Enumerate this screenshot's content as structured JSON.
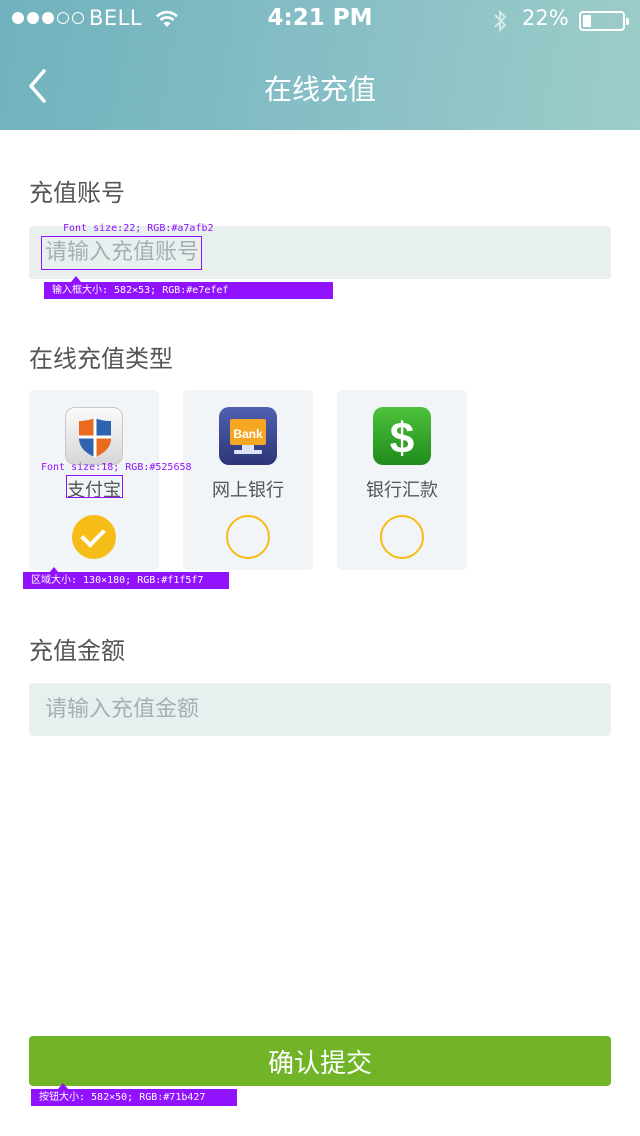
{
  "status_bar": {
    "carrier": "BELL",
    "time": "4:21 PM",
    "battery": "22%",
    "battery_level": 0.22,
    "signal_filled": 3,
    "signal_total": 5
  },
  "header": {
    "title": "在线充值",
    "back_icon": "chevron-left-icon"
  },
  "account": {
    "label": "充值账号",
    "placeholder": "请输入充值账号",
    "value": ""
  },
  "recharge_type": {
    "label": "在线充值类型",
    "options": [
      {
        "label": "支付宝",
        "icon": "alipay-shield-icon",
        "selected": true
      },
      {
        "label": "网上银行",
        "icon": "bank-monitor-icon",
        "selected": false,
        "icon_text": "Bank"
      },
      {
        "label": "银行汇款",
        "icon": "dollar-icon",
        "selected": false,
        "icon_text": "$"
      }
    ]
  },
  "amount": {
    "label": "充值金额",
    "placeholder": "请输入充值金额",
    "value": ""
  },
  "submit": {
    "label": "确认提交"
  },
  "annotations": {
    "account_font": "Font size:22; RGB:#a7afb2",
    "account_box": "输入框大小: 582×53; RGB:#e7efef",
    "option_font": "Font size:18; RGB:#525658",
    "option_box": "区域大小: 130×180; RGB:#f1f5f7",
    "button_box": "按钮大小: 582×50; RGB:#71b427"
  },
  "colors": {
    "accent_green": "#71b427",
    "radio_yellow": "#f6bc17",
    "input_bg": "#e7efef",
    "option_bg": "#f1f5f7",
    "annotation_purple": "#9112ff"
  }
}
